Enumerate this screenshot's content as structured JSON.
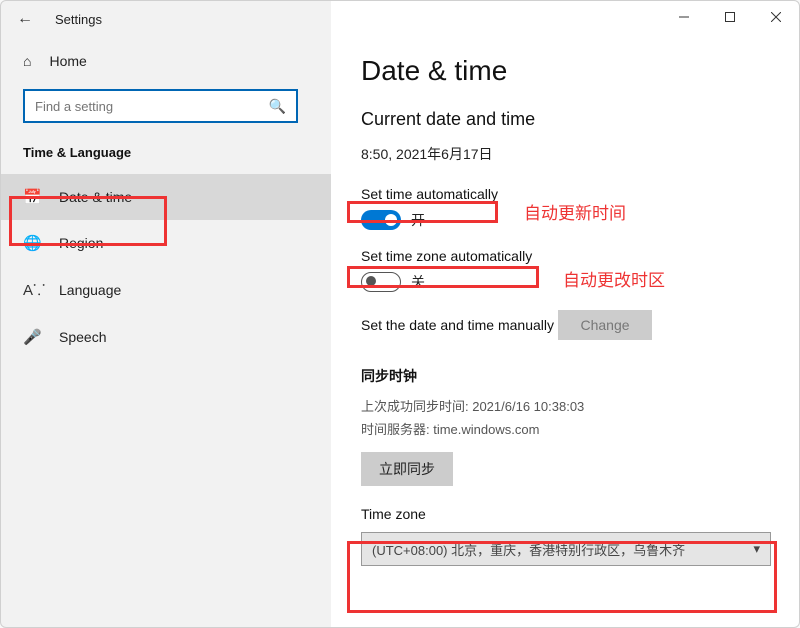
{
  "titlebar": {
    "title": "Settings"
  },
  "sidebar": {
    "home": "Home",
    "search_placeholder": "Find a setting",
    "category": "Time & Language",
    "items": [
      {
        "label": "Date & time"
      },
      {
        "label": "Region"
      },
      {
        "label": "Language"
      },
      {
        "label": "Speech"
      }
    ]
  },
  "main": {
    "heading": "Date & time",
    "subheading": "Current date and time",
    "current_datetime": "8:50, 2021年6月17日",
    "set_time_auto_label": "Set time automatically",
    "set_time_auto_state": "开",
    "set_tz_auto_label": "Set time zone automatically",
    "set_tz_auto_state": "关",
    "manual_label": "Set the date and time manually",
    "change_btn": "Change",
    "sync_title": "同步时钟",
    "sync_last": "上次成功同步时间: 2021/6/16 10:38:03",
    "sync_server": "时间服务器: time.windows.com",
    "sync_btn": "立即同步",
    "tz_label": "Time zone",
    "tz_value": "(UTC+08:00) 北京，重庆，香港特别行政区，乌鲁木齐"
  },
  "annotations": {
    "auto_time": "自动更新时间",
    "auto_tz": "自动更改时区"
  }
}
